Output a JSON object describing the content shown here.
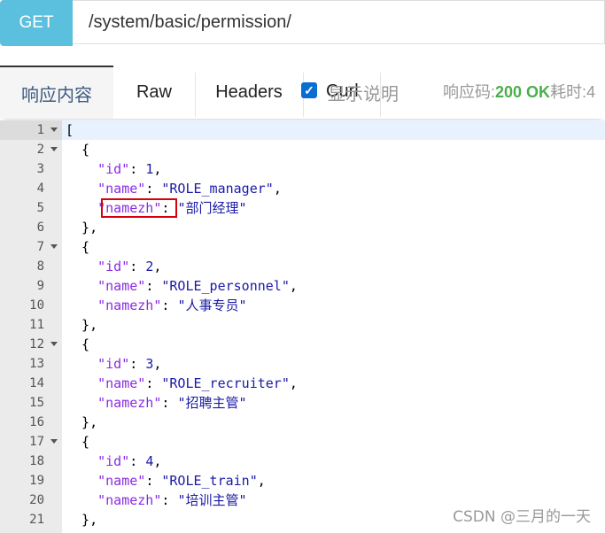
{
  "request": {
    "method": "GET",
    "url": "/system/basic/permission/"
  },
  "tabs": [
    {
      "label": "响应内容"
    },
    {
      "label": "Raw"
    },
    {
      "label": "Headers"
    },
    {
      "label": "Curl"
    }
  ],
  "options": {
    "show_desc_label": "显示说明",
    "show_desc_checked": true
  },
  "status": {
    "code_label": "响应码:",
    "code_value": "200 OK",
    "time_label": "耗时:4"
  },
  "editor": {
    "lines": [
      {
        "n": "1",
        "fold": true,
        "text": "["
      },
      {
        "n": "2",
        "fold": true,
        "text": "  {"
      },
      {
        "n": "3",
        "fold": false,
        "key": "\"id\"",
        "sep": ": ",
        "val": "1",
        "tail": ","
      },
      {
        "n": "4",
        "fold": false,
        "key": "\"name\"",
        "sep": ": ",
        "val": "\"ROLE_manager\"",
        "tail": ","
      },
      {
        "n": "5",
        "fold": false,
        "key": "\"namezh\"",
        "sep": ": ",
        "val": "\"部门经理\"",
        "tail": ""
      },
      {
        "n": "6",
        "fold": false,
        "text": "  },"
      },
      {
        "n": "7",
        "fold": true,
        "text": "  {"
      },
      {
        "n": "8",
        "fold": false,
        "key": "\"id\"",
        "sep": ": ",
        "val": "2",
        "tail": ","
      },
      {
        "n": "9",
        "fold": false,
        "key": "\"name\"",
        "sep": ": ",
        "val": "\"ROLE_personnel\"",
        "tail": ","
      },
      {
        "n": "10",
        "fold": false,
        "key": "\"namezh\"",
        "sep": ": ",
        "val": "\"人事专员\"",
        "tail": ""
      },
      {
        "n": "11",
        "fold": false,
        "text": "  },"
      },
      {
        "n": "12",
        "fold": true,
        "text": "  {"
      },
      {
        "n": "13",
        "fold": false,
        "key": "\"id\"",
        "sep": ": ",
        "val": "3",
        "tail": ","
      },
      {
        "n": "14",
        "fold": false,
        "key": "\"name\"",
        "sep": ": ",
        "val": "\"ROLE_recruiter\"",
        "tail": ","
      },
      {
        "n": "15",
        "fold": false,
        "key": "\"namezh\"",
        "sep": ": ",
        "val": "\"招聘主管\"",
        "tail": ""
      },
      {
        "n": "16",
        "fold": false,
        "text": "  },"
      },
      {
        "n": "17",
        "fold": true,
        "text": "  {"
      },
      {
        "n": "18",
        "fold": false,
        "key": "\"id\"",
        "sep": ": ",
        "val": "4",
        "tail": ","
      },
      {
        "n": "19",
        "fold": false,
        "key": "\"name\"",
        "sep": ": ",
        "val": "\"ROLE_train\"",
        "tail": ","
      },
      {
        "n": "20",
        "fold": false,
        "key": "\"namezh\"",
        "sep": ": ",
        "val": "\"培训主管\"",
        "tail": ""
      },
      {
        "n": "21",
        "fold": false,
        "text": "  },"
      }
    ]
  },
  "watermark": "CSDN @三月的一天"
}
